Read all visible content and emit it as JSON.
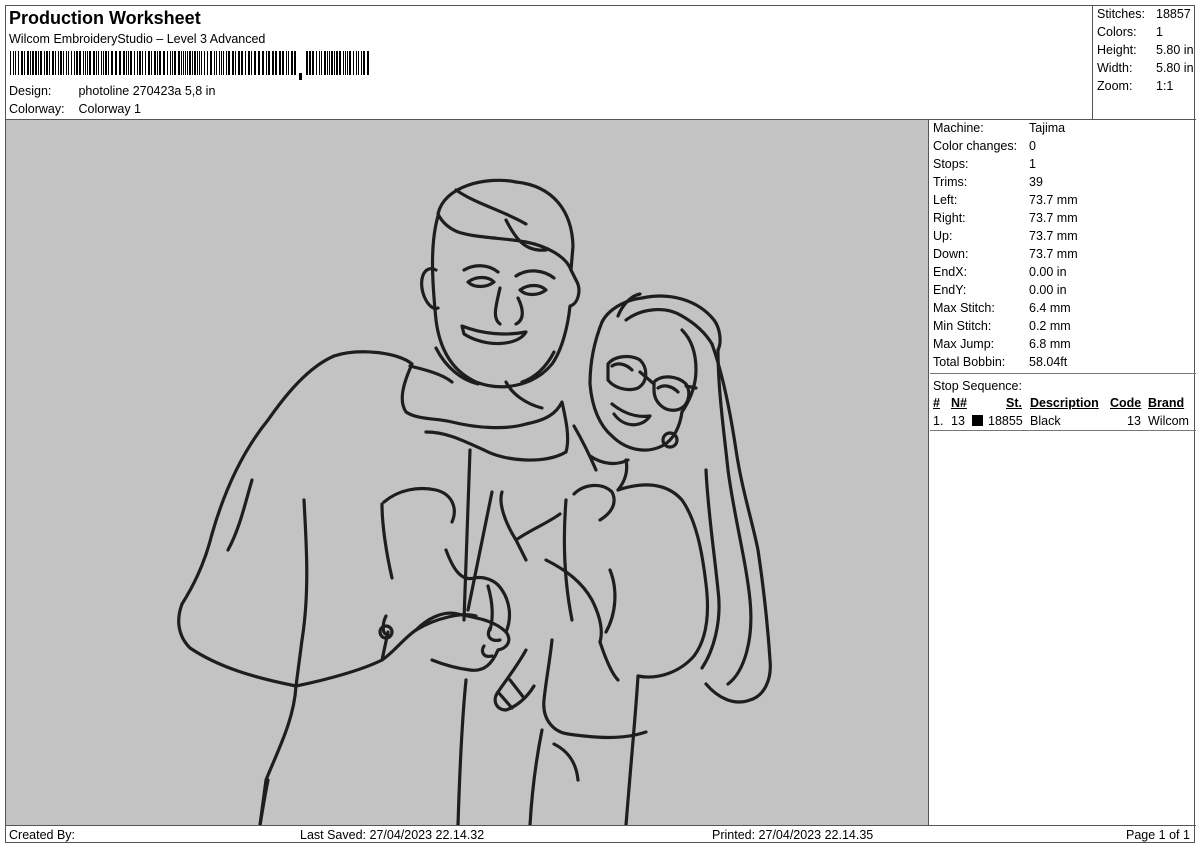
{
  "header": {
    "title": "Production Worksheet",
    "subtitle": "Wilcom EmbroideryStudio – Level 3 Advanced",
    "design_label": "Design:",
    "design_value": "photoline 270423a 5,8 in",
    "colorway_label": "Colorway:",
    "colorway_value": "Colorway 1"
  },
  "summary": [
    {
      "label": "Stitches:",
      "value": "18857"
    },
    {
      "label": "Colors:",
      "value": "1"
    },
    {
      "label": "Height:",
      "value": "5.80 in"
    },
    {
      "label": "Width:",
      "value": "5.80 in"
    },
    {
      "label": "Zoom:",
      "value": "1:1"
    }
  ],
  "machine_info": [
    {
      "label": "Machine:",
      "value": "Tajima"
    },
    {
      "label": "Color changes:",
      "value": "0"
    },
    {
      "label": "Stops:",
      "value": "1"
    },
    {
      "label": "Trims:",
      "value": "39"
    },
    {
      "label": "Left:",
      "value": "73.7 mm"
    },
    {
      "label": "Right:",
      "value": "73.7 mm"
    },
    {
      "label": "Up:",
      "value": "73.7 mm"
    },
    {
      "label": "Down:",
      "value": "73.7 mm"
    },
    {
      "label": "EndX:",
      "value": "0.00 in"
    },
    {
      "label": "EndY:",
      "value": "0.00 in"
    },
    {
      "label": "Max Stitch:",
      "value": "6.4 mm"
    },
    {
      "label": "Min Stitch:",
      "value": "0.2 mm"
    },
    {
      "label": "Max Jump:",
      "value": "6.8 mm"
    },
    {
      "label": "Total Bobbin:",
      "value": "58.04ft"
    }
  ],
  "stop_sequence": {
    "title": "Stop Sequence:",
    "headers": {
      "num": "#",
      "n": "N#",
      "st": "St.",
      "description": "Description",
      "code": "Code",
      "brand": "Brand"
    },
    "rows": [
      {
        "num": "1.",
        "n": "13",
        "swatch_color": "#000000",
        "st": "18855",
        "description": "Black",
        "code": "13",
        "brand": "Wilcom"
      }
    ]
  },
  "footer": {
    "created_by": "Created By:",
    "last_saved": "Last Saved: 27/04/2023 22.14.32",
    "printed": "Printed: 27/04/2023 22.14.35",
    "page": "Page 1 of 1"
  },
  "colors": {
    "canvas_bg": "#c3c3c3",
    "thread": "#1e1e1e"
  }
}
